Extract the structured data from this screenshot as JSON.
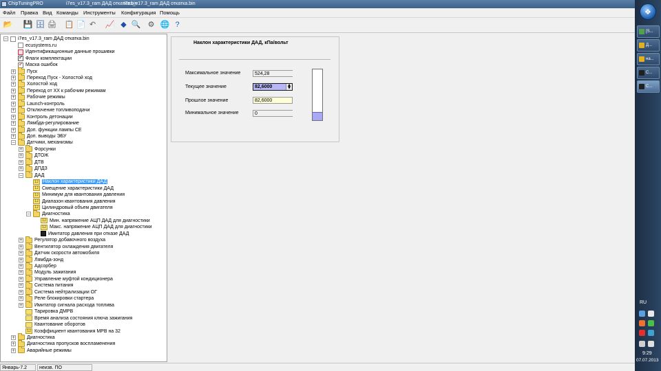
{
  "window": {
    "app_name": "ChipTuningPRO",
    "doc_title": "i7es_v17.3_ram ДАД откатка.bin",
    "doc_title_2": "i7es_v17.3_ram ДАД откатка.bin"
  },
  "menu": [
    "Файл",
    "Правка",
    "Вид",
    "Команды",
    "Инструменты",
    "Конфигурация",
    "Помощь"
  ],
  "toolbar": {
    "icons": [
      "open-folder-icon",
      "save-icon",
      "save-all-icon",
      "print-icon",
      "copy-icon",
      "paste-icon",
      "undo-icon",
      "chart-icon",
      "table-icon",
      "tree-icon",
      "search-icon",
      "tools-icon",
      "connect-icon",
      "help-icon"
    ]
  },
  "tree": {
    "root": "i7es_v17.3_ram ДАД откатка.bin",
    "items": [
      {
        "label": "ecusystems.ru",
        "icon": "doc"
      },
      {
        "label": "Идентификационные данные прошивки",
        "icon": "doc-red"
      },
      {
        "label": "Флаги комплектации",
        "icon": "flag"
      },
      {
        "label": "Маска ошибок",
        "icon": "chk"
      },
      {
        "label": "Пуск",
        "icon": "folder"
      },
      {
        "label": "Переход Пуск - Холостой ход",
        "icon": "folder"
      },
      {
        "label": "Холостой ход",
        "icon": "folder"
      },
      {
        "label": "Переход от ХХ к рабочим режимам",
        "icon": "folder"
      },
      {
        "label": "Рабочие режимы",
        "icon": "folder"
      },
      {
        "label": "Launch-контроль",
        "icon": "folder"
      },
      {
        "label": "Отключение топливоподачи",
        "icon": "folder"
      },
      {
        "label": "Контроль детонации",
        "icon": "folder"
      },
      {
        "label": "Лямбда-регулирование",
        "icon": "folder"
      },
      {
        "label": "Доп. функции лампы CE",
        "icon": "folder"
      },
      {
        "label": "Доп. выводы ЭБУ",
        "icon": "folder"
      },
      {
        "label": "Датчики, механизмы",
        "icon": "folder"
      },
      {
        "label": "Форсунки",
        "icon": "folder"
      },
      {
        "label": "ДТОЖ",
        "icon": "folder"
      },
      {
        "label": "ДТВ",
        "icon": "folder"
      },
      {
        "label": "ДПДЗ",
        "icon": "folder"
      },
      {
        "label": "ДАД",
        "icon": "folder"
      },
      {
        "label": "Наклон характеристики ДАД",
        "icon": "num"
      },
      {
        "label": "Смещение характеристики ДАД",
        "icon": "num"
      },
      {
        "label": "Минимум для квантования давления",
        "icon": "num"
      },
      {
        "label": "Диапазон квантования давления",
        "icon": "num"
      },
      {
        "label": "Цилиндровый объем двигателя",
        "icon": "num"
      },
      {
        "label": "Диагностика",
        "icon": "folder"
      },
      {
        "label": "Мин. напряжение АЦП ДАД для диагностики",
        "icon": "num"
      },
      {
        "label": "Макс. напряжение АЦП ДАД для диагностики",
        "icon": "num"
      },
      {
        "label": "Имитатор давления при отказе ДАД",
        "icon": "cfg"
      },
      {
        "label": "Регулятор добавочного воздуха",
        "icon": "folder"
      },
      {
        "label": "Вентилятор охлаждения двигателя",
        "icon": "folder"
      },
      {
        "label": "Датчик скорости автомобиля",
        "icon": "folder"
      },
      {
        "label": "Лямбда-зонд",
        "icon": "folder"
      },
      {
        "label": "Адсорбер",
        "icon": "folder"
      },
      {
        "label": "Модуль зажигания",
        "icon": "folder"
      },
      {
        "label": "Управление муфтой кондиционера",
        "icon": "folder"
      },
      {
        "label": "Система питания",
        "icon": "folder"
      },
      {
        "label": "Система нейтрализации ОГ",
        "icon": "folder"
      },
      {
        "label": "Реле блокировки стартера",
        "icon": "folder"
      },
      {
        "label": "Имитатор сигнала расхода топлива",
        "icon": "folder"
      },
      {
        "label": "Тарировка ДМРВ",
        "icon": "chart"
      },
      {
        "label": "Время анализа состояния ключа зажигания",
        "icon": "chart"
      },
      {
        "label": "Квантование оборотов",
        "icon": "chart"
      },
      {
        "label": "Коэффициент квантования МРВ на 32",
        "icon": "num"
      },
      {
        "label": "Диагностика",
        "icon": "folder"
      },
      {
        "label": "Диагностика пропусков воспламенения",
        "icon": "folder"
      },
      {
        "label": "Аварийные режимы",
        "icon": "folder"
      }
    ]
  },
  "panel": {
    "title": "Наклон характеристики ДАД, кПа/вольт",
    "max_label": "Максимальное значение",
    "max_value": "524,28",
    "cur_label": "Текущее значение",
    "cur_value": "82,6000",
    "prev_label": "Прошлое значение",
    "prev_value": "82,6000",
    "min_label": "Минимальное значение",
    "min_value": "0",
    "gauge_fraction": 0.1576
  },
  "status": {
    "firmware": "Январь-7.2",
    "software": "неизв. ПО"
  },
  "taskbar": {
    "buttons": [
      "[S...",
      "Д...",
      "на...",
      "C...",
      "C..."
    ],
    "lang": "RU",
    "time": "9:29",
    "date": "07.07.2013"
  }
}
